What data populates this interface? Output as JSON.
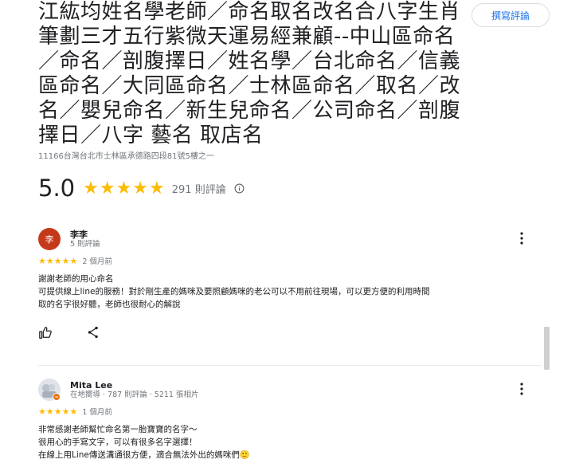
{
  "business": {
    "title": "江紘均姓名學老師／命名取名改名合八字生肖筆劃三才五行紫微天運易經兼顧--中山區命名／命名／剖腹擇日／姓名學／台北命名／信義區命名／大同區命名／士林區命名／取名／改名／嬰兒命名／新生兒命名／公司命名／剖腹擇日／八字 藝名 取店名",
    "address": "11166台灣台北市士林區承德路四段81號5樓之一",
    "write_review_label": "撰寫評論"
  },
  "rating": {
    "score": "5.0",
    "stars": "★★★★★",
    "count": "291 則評論",
    "star_color": "#fbbc04"
  },
  "reviews": [
    {
      "name": "李李",
      "avatar_text": "李",
      "avatar_color": "#c5391a",
      "sub": "5 則評論",
      "stars": "★★★★★",
      "time": "2 個月前",
      "lines": [
        "謝謝老師的用心命名",
        "可提供線上line的服務！對於剛生產的媽咪及要照顧媽咪的老公可以不用前往現場，可以更方便的利用時間",
        "取的名字很好聽，老師也很耐心的解說"
      ]
    },
    {
      "name": "Mita Lee",
      "sub": "在地嚮導 · 787 則評論 · 5211 張相片",
      "stars": "★★★★★",
      "time": "1 個月前",
      "lines": [
        "非常感謝老師幫忙命名第一胎寶寶的名字～",
        "很用心的手寫文字，可以有很多名字選擇！",
        "在線上用Line傳送溝通很方便，適合無法外出的媽咪們🙂"
      ]
    }
  ]
}
